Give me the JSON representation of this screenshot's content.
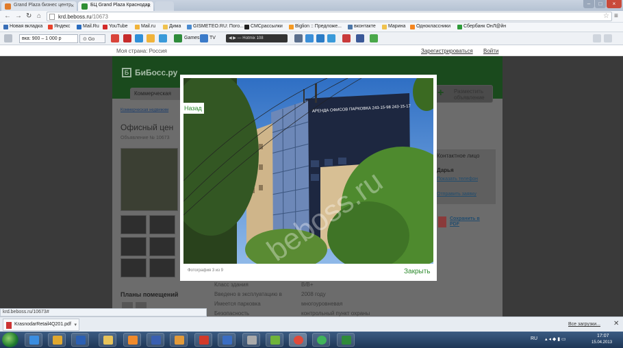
{
  "browser": {
    "tabs": [
      {
        "title": "Grand Plaza бизнес центр"
      },
      {
        "title": "БЦ Grand Plaza Краснодар"
      }
    ],
    "address": {
      "host": "krd.beboss.ru",
      "path": "/10673"
    }
  },
  "bookmarks": [
    {
      "label": "Новая вкладка",
      "color": "#3a6fb7"
    },
    {
      "label": "Яндекс",
      "color": "#e8432e"
    },
    {
      "label": "Mail.Ru",
      "color": "#2a6cbf"
    },
    {
      "label": "YouTube",
      "color": "#d32b2b"
    },
    {
      "label": "Mail.ru",
      "color": "#f0b33a"
    },
    {
      "label": "Дима",
      "color": "#f0c24e"
    },
    {
      "label": "GISMETEO.RU: Пого...",
      "color": "#4a8bd0"
    },
    {
      "label": "СМСрассылки",
      "color": "#222222"
    },
    {
      "label": "Biglion :: Предложе...",
      "color": "#f59a23"
    },
    {
      "label": "вконтакте",
      "color": "#4d77a8"
    },
    {
      "label": "Марина",
      "color": "#f0c24e"
    },
    {
      "label": "Одноклассники",
      "color": "#f5861f"
    },
    {
      "label": "Сбербанк ОнЛ@йн",
      "color": "#2e9b3a"
    }
  ],
  "addon_bar": {
    "price_value": "вка: 900 – 1 000 р",
    "go_label": "Go",
    "games_label": "Games",
    "tv_label": "TV",
    "radio_label": "Hotmix 108"
  },
  "page_header": {
    "country": "Моя страна: Россия",
    "register": "Зарегистрироваться",
    "login": "Войти"
  },
  "site": {
    "logo_letter": "Б",
    "logo_text": "БиБосс.ру",
    "tab_commercial": "Коммерческая",
    "place_ad": "Разместить объявление",
    "breadcrumb": "Коммерческая недвижим",
    "title": "Офисный цен",
    "ad_number": "Объявление № 10673",
    "contact_title": "Контактное лицо",
    "contact_name": "Дарья",
    "show_phone": "Показать телефон",
    "send_message": "Отправить заявку",
    "save_pdf": "Сохранить в PDF",
    "plans_title": "Планы помещений",
    "details": [
      {
        "label": "Класс здания",
        "value": "B/B+"
      },
      {
        "label": "Введено в эксплуатацию в",
        "value": "2008 году"
      },
      {
        "label": "Имеется парковка",
        "value": "многоуровневая"
      },
      {
        "label": "Безопасность",
        "value": "контрольный пункт охраны"
      }
    ]
  },
  "lightbox": {
    "back": "Назад",
    "counter": "Фотография 3 из 9",
    "close": "Закрыть",
    "watermark": "beboss.ru",
    "sign_text": "АРЕНДА ОФИСОВ ПАРКОВКА 243-15-98 243-15-17"
  },
  "status": {
    "url": "krd.beboss.ru/10673#"
  },
  "downloads": {
    "file": "KrasnodarRetail4Q201.pdf",
    "all": "Все загрузки..."
  },
  "taskbar": {
    "lang": "RU",
    "time": "17:07",
    "date": "15.04.2013"
  }
}
